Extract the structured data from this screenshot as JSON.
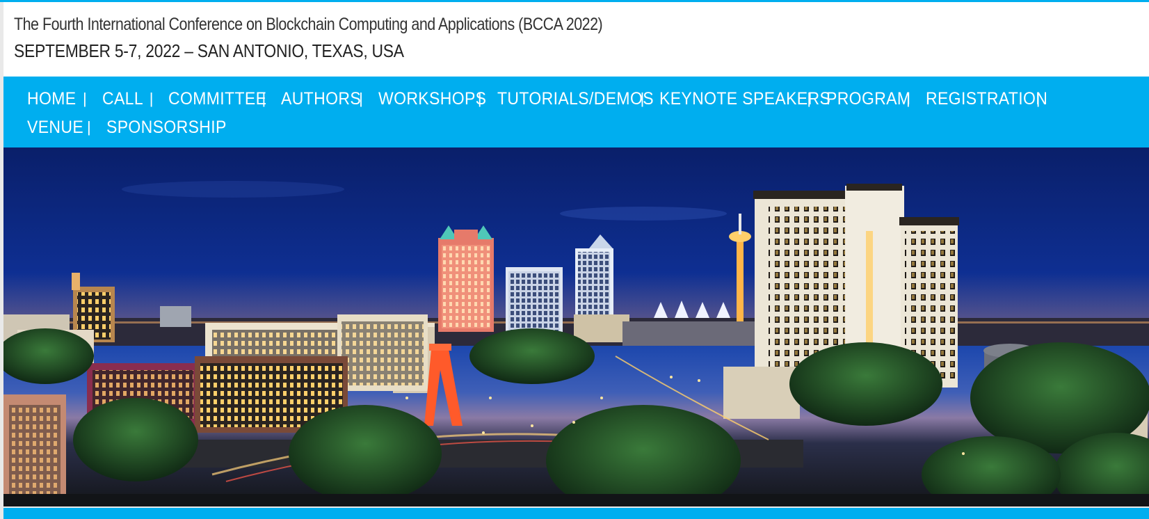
{
  "header": {
    "title": "The Fourth International Conference on Blockchain Computing and Applications (BCCA 2022)",
    "subtitle": "SEPTEMBER 5-7, 2022 – SAN ANTONIO, TEXAS, USA"
  },
  "nav": {
    "separator": "|",
    "items": [
      {
        "label": "HOME"
      },
      {
        "label": "CALL"
      },
      {
        "label": "COMMITTEE"
      },
      {
        "label": "AUTHORS"
      },
      {
        "label": "WORKSHOPS"
      },
      {
        "label": "TUTORIALS/DEMOS"
      },
      {
        "label": "KEYNOTE SPEAKERS"
      },
      {
        "label": "PROGRAM"
      },
      {
        "label": "REGISTRATION"
      },
      {
        "label": "VENUE"
      },
      {
        "label": "SPONSORSHIP"
      }
    ]
  },
  "colors": {
    "accent": "#00aeef",
    "nav_text": "#ffffff",
    "title_text": "#333333"
  }
}
